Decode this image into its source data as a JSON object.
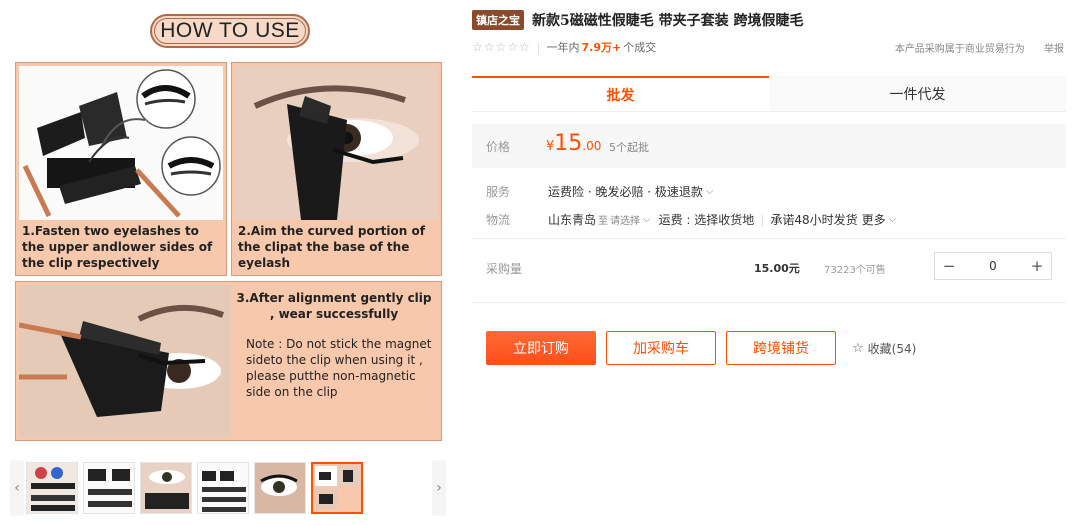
{
  "image": {
    "how_to_use": "HOW TO USE",
    "step1": "1.Fasten two eyelashes to the upper andlower sides of the clip respectively",
    "step2": "2.Aim the curved portion of the clipat the base of the eyelash",
    "step3": "3.After alignment gently clip , wear successfully",
    "note": "Note : Do not stick the magnet sideto the clip when using it , please putthe non-magnetic side on the clip"
  },
  "thumbnails": {
    "prev_icon": "chevron-left-icon",
    "next_icon": "chevron-right-icon",
    "count": 6,
    "active_index": 5
  },
  "product": {
    "shop_badge": "镇店之宝",
    "title": "新款5磁磁性假睫毛 带夹子套装 跨境假睫毛",
    "stars_icon": "star-outline-icon",
    "stars": "☆☆☆☆☆",
    "sales_prefix": "一年内",
    "sales_count": "7.9万+",
    "sales_suffix": "个成交",
    "notice": "本产品采购属于商业贸易行为",
    "report": "举报"
  },
  "tabs": [
    "批发",
    "一件代发"
  ],
  "price": {
    "label": "价格",
    "currency": "¥",
    "integer": "15",
    "decimal": ".00",
    "moq": "5个起批"
  },
  "service": {
    "label": "服务",
    "value": "运费险 · 晚发必赔 · 极速退款"
  },
  "logistics": {
    "label": "物流",
    "from": "山东青岛",
    "to_prefix": "至",
    "to_value": "请选择",
    "freight": "运费 : 选择收货地",
    "promise": "承诺48小时发货",
    "more": "更多"
  },
  "purchase": {
    "label": "采购量",
    "unit_price": "15.00元",
    "stock": "73223个可售",
    "quantity": "0",
    "minus": "−",
    "plus": "+"
  },
  "actions": {
    "buy": "立即订购",
    "add_cart": "加采购车",
    "distribute": "跨境铺货",
    "favorite": "收藏(54)"
  },
  "colors": {
    "accent": "#ff5000",
    "badge": "#8b4a2b",
    "panel": "#f7c8ac"
  }
}
